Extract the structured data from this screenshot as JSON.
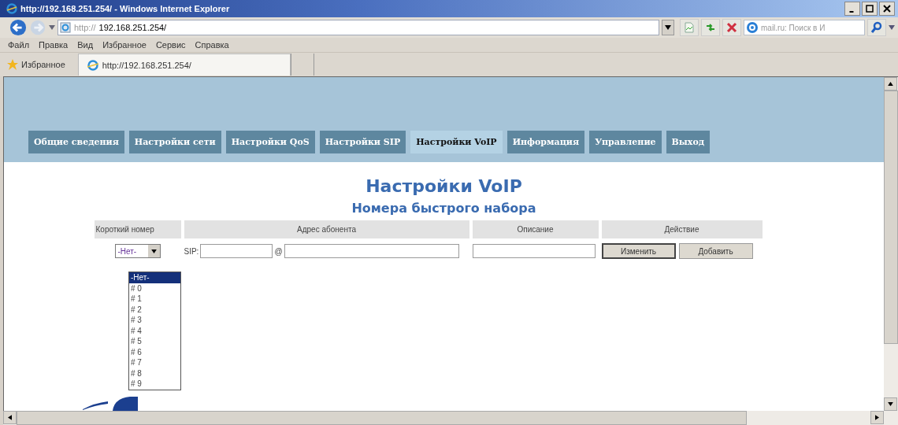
{
  "window": {
    "title": "http://192.168.251.254/ - Windows Internet Explorer"
  },
  "address_bar": {
    "url_prefix": "http://",
    "url": "192.168.251.254/",
    "search_placeholder": "mail.ru: Поиск в И"
  },
  "menu": [
    "Файл",
    "Правка",
    "Вид",
    "Избранное",
    "Сервис",
    "Справка"
  ],
  "favorites_bar": {
    "label": "Избранное",
    "tab": "http://192.168.251.254/"
  },
  "nav_tabs": [
    {
      "label": "Общие сведения",
      "selected": false
    },
    {
      "label": "Настройки сети",
      "selected": false
    },
    {
      "label": "Настройки QoS",
      "selected": false
    },
    {
      "label": "Настройки SIP",
      "selected": false
    },
    {
      "label": "Настройки VoIP",
      "selected": true
    },
    {
      "label": "Информация",
      "selected": false
    },
    {
      "label": "Управление",
      "selected": false
    },
    {
      "label": "Выход",
      "selected": false
    }
  ],
  "heading": "Настройки VoIP",
  "subheading": "Номера быстрого набора",
  "table": {
    "columns": [
      "Короткий номер",
      "Адрес абонента",
      "Описание",
      "Действие"
    ],
    "row": {
      "short_number": "-Нет-",
      "sip_label": "SIP:",
      "at_sign": "@",
      "buttons": [
        {
          "label": "Изменить",
          "focused": true
        },
        {
          "label": "Добавить",
          "focused": false
        }
      ]
    }
  },
  "dropdown": {
    "options": [
      {
        "label": "-Нет-",
        "selected": true
      },
      {
        "label": "# 0",
        "selected": false
      },
      {
        "label": "# 1",
        "selected": false
      },
      {
        "label": "# 2",
        "selected": false
      },
      {
        "label": "# 3",
        "selected": false
      },
      {
        "label": "# 4",
        "selected": false
      },
      {
        "label": "# 5",
        "selected": false
      },
      {
        "label": "# 6",
        "selected": false
      },
      {
        "label": "# 7",
        "selected": false
      },
      {
        "label": "# 8",
        "selected": false
      },
      {
        "label": "# 9",
        "selected": false
      }
    ]
  }
}
